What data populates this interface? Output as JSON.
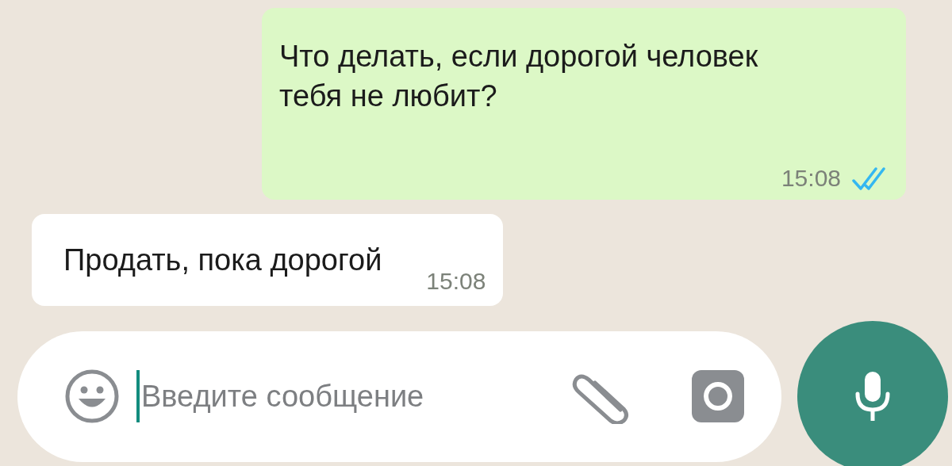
{
  "messages": [
    {
      "kind": "outgoing",
      "text": "Что делать, если дорогой человек тебя не любит?",
      "time": "15:08",
      "read": true
    },
    {
      "kind": "incoming",
      "text": "Продать, пока дорогой",
      "time": "15:08"
    }
  ],
  "composer": {
    "placeholder": "Введите сообщение"
  }
}
